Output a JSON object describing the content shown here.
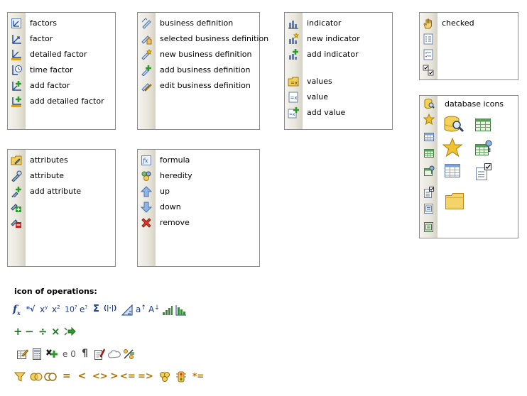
{
  "panel_factors": {
    "items": [
      {
        "label": "factors",
        "icon": "factors-icon"
      },
      {
        "label": "factor",
        "icon": "factor-icon"
      },
      {
        "label": "detailed factor",
        "icon": "detailed-factor-icon"
      },
      {
        "label": "time factor",
        "icon": "time-factor-icon"
      },
      {
        "label": "add factor",
        "icon": "add-factor-icon"
      },
      {
        "label": "add detailed factor",
        "icon": "add-detailed-factor-icon"
      }
    ]
  },
  "panel_business": {
    "items": [
      {
        "label": "business definition",
        "icon": "business-definition-icon"
      },
      {
        "label": "selected business definition",
        "icon": "selected-business-definition-icon"
      },
      {
        "label": "new business definition",
        "icon": "new-business-definition-icon"
      },
      {
        "label": "add business definition",
        "icon": "add-business-definition-icon"
      },
      {
        "label": "edit business definition",
        "icon": "edit-business-definition-icon"
      }
    ]
  },
  "panel_indicator": {
    "items": [
      {
        "label": "indicator",
        "icon": "indicator-icon"
      },
      {
        "label": "new indicator",
        "icon": "new-indicator-icon"
      },
      {
        "label": "add indicator",
        "icon": "add-indicator-icon"
      },
      {
        "label": "values",
        "icon": "values-icon"
      },
      {
        "label": "value",
        "icon": "value-icon"
      },
      {
        "label": "add value",
        "icon": "add-value-icon"
      }
    ]
  },
  "panel_checked": {
    "items": [
      {
        "label": "checked",
        "icon": "hand-icon"
      }
    ]
  },
  "panel_database": {
    "title": "database icons"
  },
  "panel_attributes": {
    "items": [
      {
        "label": "attributes",
        "icon": "attributes-icon"
      },
      {
        "label": "attribute",
        "icon": "attribute-icon"
      },
      {
        "label": "add attribute",
        "icon": "add-attribute-icon"
      }
    ]
  },
  "panel_formula": {
    "items": [
      {
        "label": "formula",
        "icon": "formula-icon"
      },
      {
        "label": "heredity",
        "icon": "heredity-icon"
      },
      {
        "label": "up",
        "icon": "up-arrow-icon"
      },
      {
        "label": "down",
        "icon": "down-arrow-icon"
      },
      {
        "label": "remove",
        "icon": "remove-icon"
      }
    ]
  },
  "operations": {
    "title": "icon of operations:",
    "row1": {
      "fx": "f",
      "fx_sub": "x",
      "root": "ⁿ√",
      "pow_y": "x",
      "pow_y_sup": "y",
      "pow_2": "x",
      "pow_2_sup": "2",
      "ten_pow": "10",
      "ten_pow_sup": "?",
      "e_pow": "e",
      "e_pow_sup": "?",
      "sigma": "Σ",
      "abs": "(|·|)",
      "a_up": "a",
      "a_up_arrow": "↑",
      "a_down": "A",
      "a_down_arrow": "↓"
    },
    "row2": {
      "plus": "+",
      "minus": "−",
      "divide": "÷",
      "times": "×"
    },
    "row3": {
      "e_zero": "e 0",
      "pilcrow": "¶"
    },
    "row4": {
      "lt_eq": "=  <",
      "neq": "<>",
      "gt": ">",
      "le": "<=",
      "ge": "=>",
      "star_eq": "*="
    }
  },
  "colors": {
    "border": "#8c8c8c",
    "op_blue": "#1a3c8c",
    "op_green": "#1e7a1e",
    "op_orange": "#b07000"
  }
}
